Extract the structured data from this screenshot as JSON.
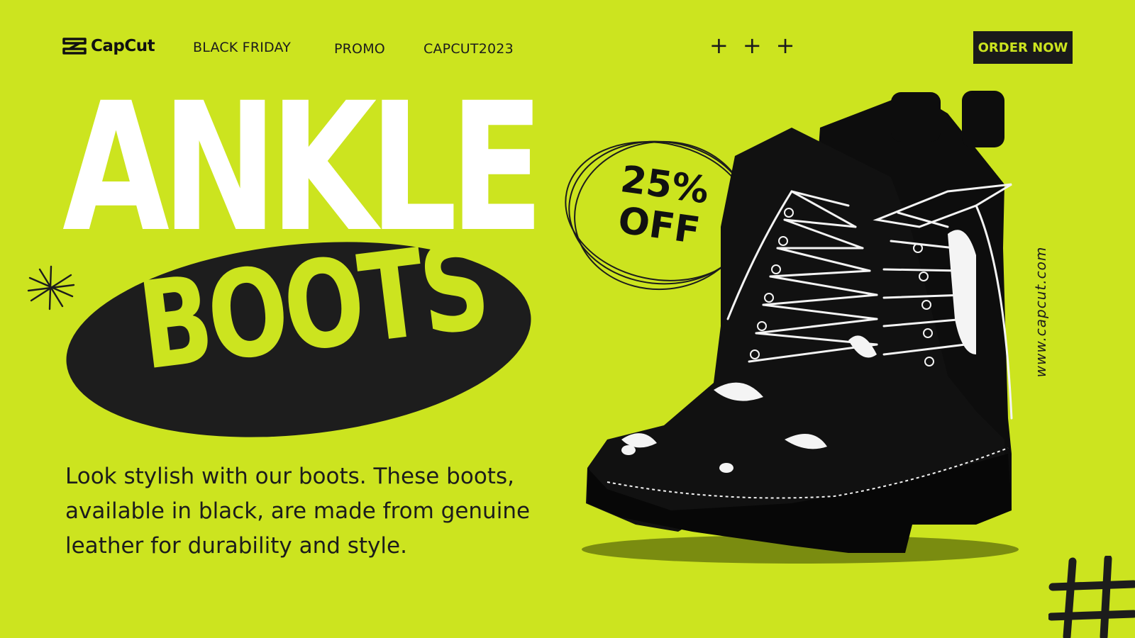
{
  "brand": {
    "name": "CapCut",
    "logo_icon": "capcut-logo-icon"
  },
  "nav": {
    "links": [
      "BLACK FRIDAY",
      "PROMO",
      "CAPCUT2023"
    ],
    "plus_glyph": "+",
    "order_button": "ORDER NOW"
  },
  "hero": {
    "title_line1": "ANKLE",
    "title_line2": "BOOTS",
    "description": "Look stylish with our boots. These boots, available in black, are made from genuine leather for durability and style."
  },
  "promo": {
    "line1": "25%",
    "line2": "OFF"
  },
  "website": "www.capcut.com",
  "colors": {
    "background": "#cce41f",
    "dark": "#1d1d1d",
    "title": "#ffffff",
    "shadow": "#7a8c10"
  }
}
